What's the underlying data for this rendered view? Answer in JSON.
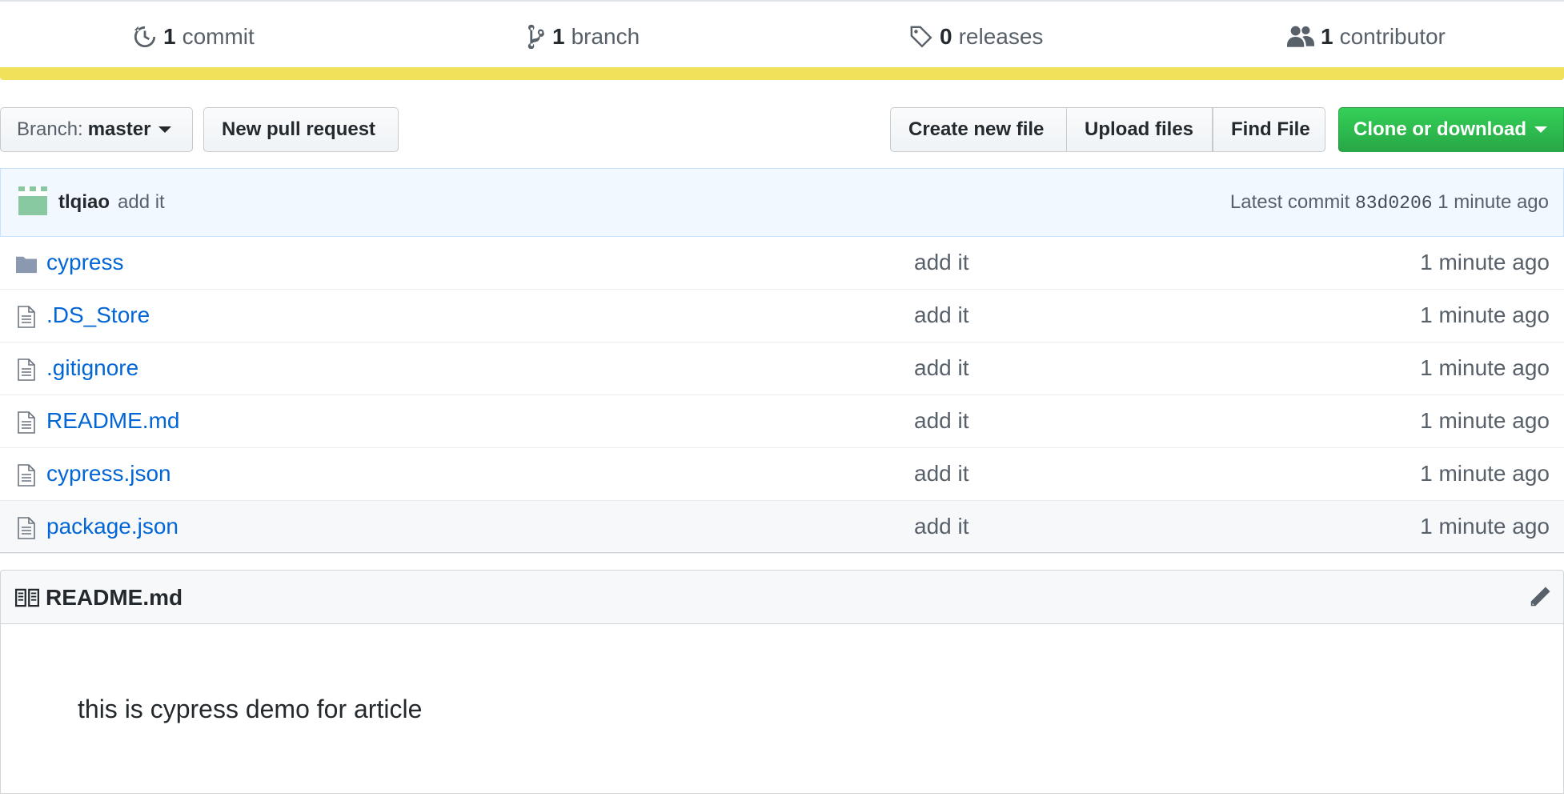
{
  "summary": {
    "commits": {
      "count": "1",
      "label": "commit",
      "icon": "history-icon"
    },
    "branches": {
      "count": "1",
      "label": "branch",
      "icon": "git-branch-icon"
    },
    "releases": {
      "count": "0",
      "label": "releases",
      "icon": "tag-icon"
    },
    "contributors": {
      "count": "1",
      "label": "contributor",
      "icon": "people-icon"
    }
  },
  "language_bar_color": "#f1e05a",
  "toolbar": {
    "branch_prefix": "Branch:",
    "branch_name": "master",
    "new_pull_request": "New pull request",
    "create_new_file": "Create new file",
    "upload_files": "Upload files",
    "find_file": "Find File",
    "clone_or_download": "Clone or download"
  },
  "latest_commit": {
    "author": "tlqiao",
    "message": "add it",
    "prefix": "Latest commit",
    "sha": "83d0206",
    "age": "1 minute ago"
  },
  "files": [
    {
      "name": "cypress",
      "type": "folder",
      "message": "add it",
      "age": "1 minute ago"
    },
    {
      "name": ".DS_Store",
      "type": "file",
      "message": "add it",
      "age": "1 minute ago"
    },
    {
      "name": ".gitignore",
      "type": "file",
      "message": "add it",
      "age": "1 minute ago"
    },
    {
      "name": "README.md",
      "type": "file",
      "message": "add it",
      "age": "1 minute ago"
    },
    {
      "name": "cypress.json",
      "type": "file",
      "message": "add it",
      "age": "1 minute ago"
    },
    {
      "name": "package.json",
      "type": "file",
      "message": "add it",
      "age": "1 minute ago"
    }
  ],
  "readme": {
    "title": "README.md",
    "content": "this is cypress demo for article"
  },
  "colors": {
    "link": "#0366d6",
    "primary_button": "#28a745",
    "commit_bar": "#f1f8ff"
  }
}
